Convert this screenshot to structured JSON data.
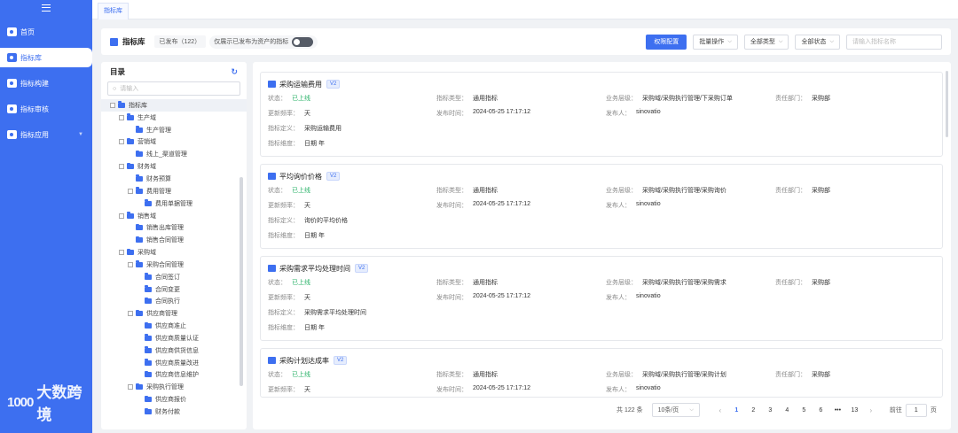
{
  "sidebar": {
    "items": [
      {
        "label": "首页"
      },
      {
        "label": "指标库"
      },
      {
        "label": "指标构建"
      },
      {
        "label": "指标审核"
      },
      {
        "label": "指标应用"
      }
    ],
    "logo_mark": "1000",
    "logo_text": "大数跨境"
  },
  "topbar": {
    "tab_label": "指标库"
  },
  "header": {
    "title": "指标库",
    "published": "已发布（122）",
    "only_published_label": "仅展示已发布为资产的指标",
    "perm_button": "权限配置",
    "batch_label": "批量操作",
    "type_label": "全部类型",
    "status_label": "全部状态",
    "search_placeholder": "请输入指标名称"
  },
  "tree": {
    "title": "目录",
    "search_placeholder": "请输入",
    "nodes": [
      {
        "label": "指标库",
        "level": 0,
        "exp": true
      },
      {
        "label": "生产域",
        "level": 1,
        "exp": true
      },
      {
        "label": "生产管理",
        "level": 2,
        "exp": false
      },
      {
        "label": "营销域",
        "level": 1,
        "exp": true
      },
      {
        "label": "线上_渠道管理",
        "level": 2,
        "exp": false
      },
      {
        "label": "财务域",
        "level": 1,
        "exp": true
      },
      {
        "label": "财务预算",
        "level": 2,
        "exp": false
      },
      {
        "label": "费用管理",
        "level": 2,
        "exp": true
      },
      {
        "label": "费用单据管理",
        "level": 3,
        "exp": false
      },
      {
        "label": "销售域",
        "level": 1,
        "exp": true
      },
      {
        "label": "销售出库管理",
        "level": 2,
        "exp": false
      },
      {
        "label": "销售合同管理",
        "level": 2,
        "exp": false
      },
      {
        "label": "采购域",
        "level": 1,
        "exp": true
      },
      {
        "label": "采购合同管理",
        "level": 2,
        "exp": true
      },
      {
        "label": "合同签订",
        "level": 3,
        "exp": false
      },
      {
        "label": "合同变更",
        "level": 3,
        "exp": false
      },
      {
        "label": "合同执行",
        "level": 3,
        "exp": false
      },
      {
        "label": "供应商管理",
        "level": 2,
        "exp": true
      },
      {
        "label": "供应商准止",
        "level": 3,
        "exp": false
      },
      {
        "label": "供应商质量认证",
        "level": 3,
        "exp": false
      },
      {
        "label": "供应商供货信息",
        "level": 3,
        "exp": false
      },
      {
        "label": "供应商质量改进",
        "level": 3,
        "exp": false
      },
      {
        "label": "供应商信息维护",
        "level": 3,
        "exp": false
      },
      {
        "label": "采购执行管理",
        "level": 2,
        "exp": true
      },
      {
        "label": "供应商报价",
        "level": 3,
        "exp": false
      },
      {
        "label": "财务付款",
        "level": 3,
        "exp": false
      }
    ]
  },
  "labels": {
    "status": "状态：",
    "type": "指标类型：",
    "biz_level": "业务层级：",
    "dept": "责任部门：",
    "freq": "更新频率：",
    "pub_time": "发布时间：",
    "publisher": "发布人：",
    "definition": "指标定义：",
    "dimension": "指标维度："
  },
  "cards": [
    {
      "title": "采购运输费用",
      "version": "V2",
      "status": "已上线",
      "type": "通用指标",
      "biz_level": "采购域/采购执行管理/下采购订单",
      "dept": "采购部",
      "freq": "天",
      "pub_time": "2024-05-25 17:17:12",
      "publisher": "sinovatio",
      "definition": "采购运输费用",
      "dimension": "日期 年"
    },
    {
      "title": "平均询价价格",
      "version": "V2",
      "status": "已上线",
      "type": "通用指标",
      "biz_level": "采购域/采购执行管理/采购询价",
      "dept": "采购部",
      "freq": "天",
      "pub_time": "2024-05-25 17:17:12",
      "publisher": "sinovatio",
      "definition": "询价的平均价格",
      "dimension": "日期 年"
    },
    {
      "title": "采购需求平均处理时间",
      "version": "V2",
      "status": "已上线",
      "type": "通用指标",
      "biz_level": "采购域/采购执行管理/采购需求",
      "dept": "采购部",
      "freq": "天",
      "pub_time": "2024-05-25 17:17:12",
      "publisher": "sinovatio",
      "definition": "采购需求平均处理时间",
      "dimension": "日期 年"
    },
    {
      "title": "采购计划达成率",
      "version": "V2",
      "status": "已上线",
      "type": "通用指标",
      "biz_level": "采购域/采购执行管理/采购计划",
      "dept": "采购部",
      "freq": "天",
      "pub_time": "2024-05-25 17:17:12",
      "publisher": "sinovatio"
    }
  ],
  "pager": {
    "total": "共 122 条",
    "page_size": "10条/页",
    "prev": "‹",
    "next": "›",
    "pages": [
      "1",
      "2",
      "3",
      "4",
      "5",
      "6",
      "•••",
      "13"
    ],
    "goto_label": "前往",
    "goto_value": "1",
    "goto_suffix": "页"
  }
}
